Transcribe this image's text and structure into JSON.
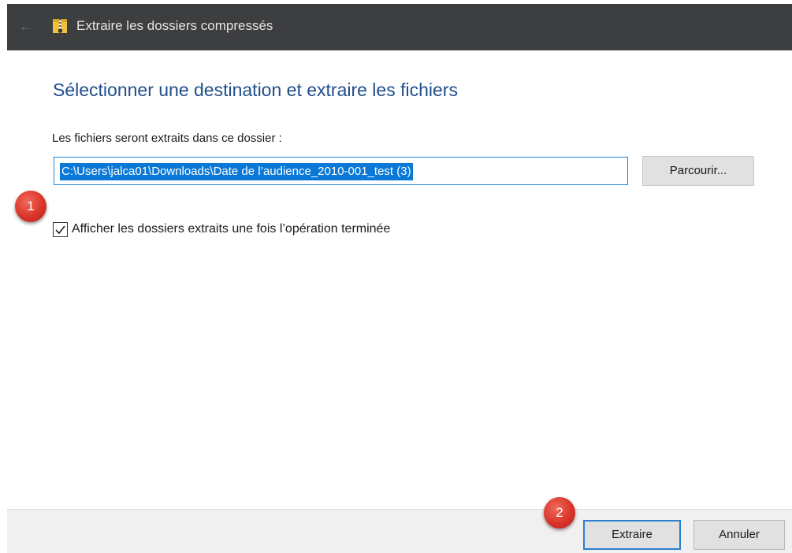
{
  "window": {
    "title": "Extraire les dossiers compressés",
    "back_glyph": "←"
  },
  "dialog": {
    "heading": "Sélectionner une destination et extraire les fichiers",
    "folder_label": "Les fichiers seront extraits dans ce dossier :",
    "path_value": "C:\\Users\\jalca01\\Downloads\\Date de l’audience_2010-001_test (3)",
    "browse_label": "Parcourir...",
    "show_files_checked": true,
    "show_files_label": "Afficher les dossiers extraits une fois l’opération terminée"
  },
  "footer": {
    "extract_label": "Extraire",
    "cancel_label": "Annuler"
  },
  "annotations": {
    "step1": "1",
    "step2": "2"
  },
  "icons": {
    "back": "back-arrow-icon",
    "zip": "zip-folder-icon",
    "check": "checkmark-icon"
  },
  "colors": {
    "titlebar": "#3d3e40",
    "heading": "#1f4e8c",
    "selection": "#0a78d7",
    "focus_border": "#2a7fd1",
    "badge": "#d9342a"
  }
}
